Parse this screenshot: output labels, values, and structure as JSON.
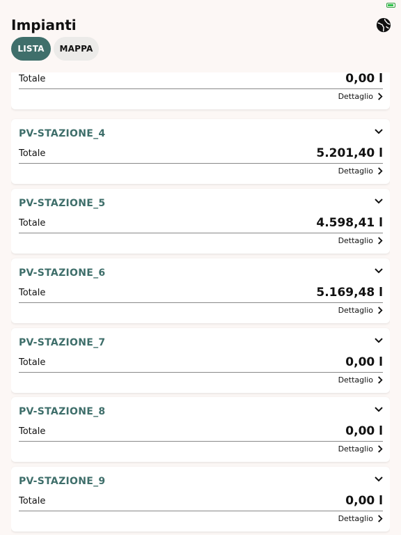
{
  "header": {
    "title": "Impianti",
    "globe_icon": "globe-icon"
  },
  "tabs": [
    {
      "label": "LISTA",
      "active": true
    },
    {
      "label": "MAPPA",
      "active": false
    }
  ],
  "colors": {
    "accent": "#3f6f6b",
    "station_name": "#3e6e6a",
    "background": "#fcf7f5"
  },
  "stations": [
    {
      "name": "",
      "total_label": "Totale",
      "total_value": "0,00 l",
      "detail_label": "Dettaglio"
    },
    {
      "name": "PV-STAZIONE_4",
      "total_label": "Totale",
      "total_value": "5.201,40 l",
      "detail_label": "Dettaglio"
    },
    {
      "name": "PV-STAZIONE_5",
      "total_label": "Totale",
      "total_value": "4.598,41 l",
      "detail_label": "Dettaglio"
    },
    {
      "name": "PV-STAZIONE_6",
      "total_label": "Totale",
      "total_value": "5.169,48 l",
      "detail_label": "Dettaglio"
    },
    {
      "name": "PV-STAZIONE_7",
      "total_label": "Totale",
      "total_value": "0,00 l",
      "detail_label": "Dettaglio"
    },
    {
      "name": "PV-STAZIONE_8",
      "total_label": "Totale",
      "total_value": "0,00 l",
      "detail_label": "Dettaglio"
    },
    {
      "name": "PV-STAZIONE_9",
      "total_label": "Totale",
      "total_value": "0,00 l",
      "detail_label": "Dettaglio"
    }
  ]
}
